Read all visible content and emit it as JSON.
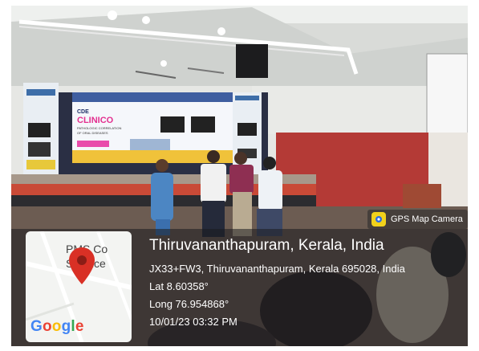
{
  "app_badge": {
    "label": "GPS Map Camera",
    "icon": "gps-camera-icon"
  },
  "map": {
    "place_label_line1": "PMS Co",
    "place_label_line2": "Science",
    "logo": "Google",
    "pin_color": "#d93025"
  },
  "location": {
    "title": "Thiruvananthapuram, Kerala, India",
    "address": "JX33+FW3, Thiruvananthapuram, Kerala 695028, India",
    "lat": "Lat 8.60358°",
    "long": "Long 76.954868°",
    "datetime": "10/01/23 03:32 PM"
  },
  "screen": {
    "line1": "CDE",
    "line2": "CLINICO",
    "line3": "PATHOLOGIC CORRELATION",
    "line4": "OF ORAL DISEASES"
  }
}
